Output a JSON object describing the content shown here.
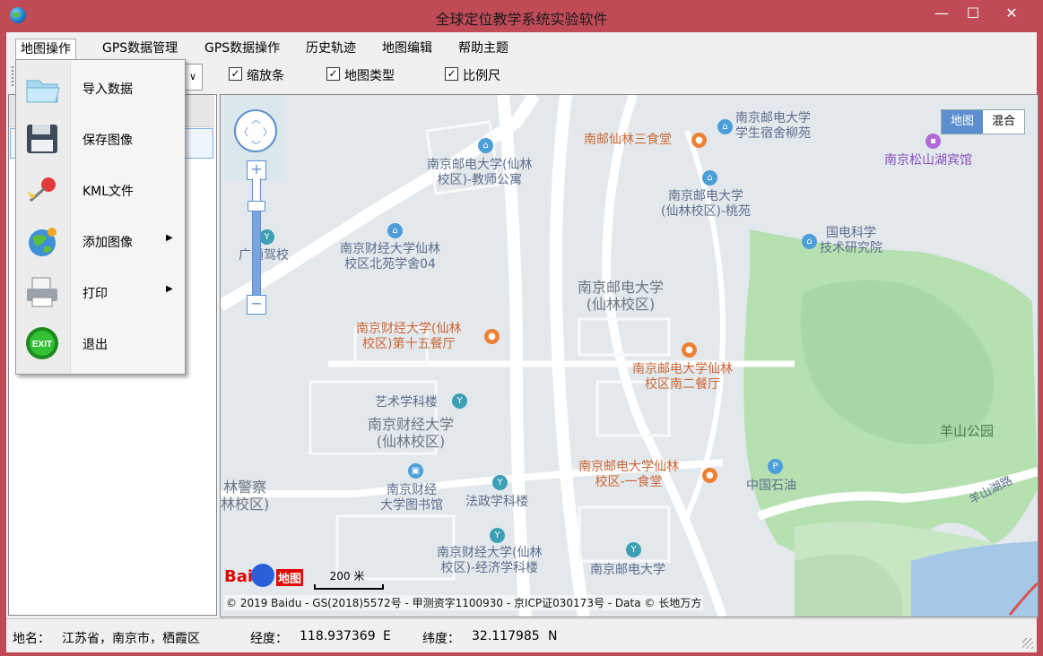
{
  "window": {
    "title": "全球定位教学系统实验软件",
    "min_glyph": "—",
    "max_glyph": "☐",
    "close_glyph": "✕"
  },
  "menubar": {
    "items": [
      {
        "label": "地图操作"
      },
      {
        "label": "GPS数据管理"
      },
      {
        "label": "GPS数据操作"
      },
      {
        "label": "历史轨迹"
      },
      {
        "label": "地图编辑"
      },
      {
        "label": "帮助主题"
      }
    ]
  },
  "toolbar": {
    "combo_arrow": "∨",
    "checkboxes": [
      {
        "label": "缩放条",
        "checked": true
      },
      {
        "label": "地图类型",
        "checked": true
      },
      {
        "label": "比例尺",
        "checked": true
      }
    ],
    "check_glyph": "✓"
  },
  "dropdown": {
    "items": [
      {
        "label": "导入数据",
        "icon": "folder-icon",
        "submenu": false
      },
      {
        "label": "保存图像",
        "icon": "floppy-disk-icon",
        "submenu": false
      },
      {
        "label": "KML文件",
        "icon": "map-pin-icon",
        "submenu": false
      },
      {
        "label": "添加图像",
        "icon": "globe-icon",
        "submenu": true
      },
      {
        "label": "打印",
        "icon": "printer-icon",
        "submenu": true
      },
      {
        "label": "退出",
        "icon": "exit-icon",
        "submenu": false
      }
    ],
    "submenu_glyph": "▶",
    "exit_icon_text": "EXIT"
  },
  "map": {
    "type_selector": {
      "active": "地图",
      "inactive": "混合"
    },
    "labels": [
      {
        "text": "南京邮电大学\n学生宿舍柳苑",
        "style": "blue"
      },
      {
        "text": "南邮仙林三食堂",
        "style": "orange"
      },
      {
        "text": "南京松山湖宾馆",
        "style": "purple"
      },
      {
        "text": "南京邮电大学(仙林\n校区)-教师公寓",
        "style": "blue"
      },
      {
        "text": "南京邮电大学\n(仙林校区)-桃苑",
        "style": "blue"
      },
      {
        "text": "国电科学\n技术研究院",
        "style": "blue"
      },
      {
        "text": "广通驾校",
        "style": "blue"
      },
      {
        "text": "南京财经大学仙林\n校区北苑学舍04",
        "style": "blue"
      },
      {
        "text": "南京邮电大学\n(仙林校区)",
        "style": "big"
      },
      {
        "text": "南京财经大学(仙林\n校区)第十五餐厅",
        "style": "orange"
      },
      {
        "text": "南京邮电大学仙林\n校区南二餐厅",
        "style": "orange"
      },
      {
        "text": "艺术学科楼",
        "style": "blue"
      },
      {
        "text": "南京财经大学\n(仙林校区)",
        "style": "big"
      },
      {
        "text": "羊山公园",
        "style": "park"
      },
      {
        "text": "林警察\n林校区)",
        "style": "big"
      },
      {
        "text": "南京财经\n大学图书馆",
        "style": "blue"
      },
      {
        "text": "法政学科楼",
        "style": "blue"
      },
      {
        "text": "南京邮电大学仙林\n校区-一食堂",
        "style": "orange"
      },
      {
        "text": "中国石油",
        "style": "blue"
      },
      {
        "text": "羊山湖路",
        "style": "road"
      },
      {
        "text": "南京财经大学(仙林\n校区)-经济学科楼",
        "style": "blue"
      },
      {
        "text": "南京邮电大学",
        "style": "blue"
      }
    ],
    "scale_label": "200 米",
    "baidu_logo_text": "Bai",
    "baidu_logo_text2": "地图",
    "copyright": "© 2019 Baidu - GS(2018)5572号 - 甲测资字1100930 - 京ICP证030173号 - Data © 长地万方"
  },
  "statusbar": {
    "place_label": "地名：",
    "place_value": "江苏省，南京市，栖霞区",
    "lon_label": "经度：",
    "lon_value": "118.937369",
    "lon_dir": "E",
    "lat_label": "纬度：",
    "lat_value": "32.117985",
    "lat_dir": "N"
  },
  "colors": {
    "titlebar": "#c04b57",
    "map_bg": "#e8ecef",
    "park_green": "#b5e0b0",
    "water_blue": "#a5c8e8",
    "accent_blue": "#5d8fd0"
  }
}
